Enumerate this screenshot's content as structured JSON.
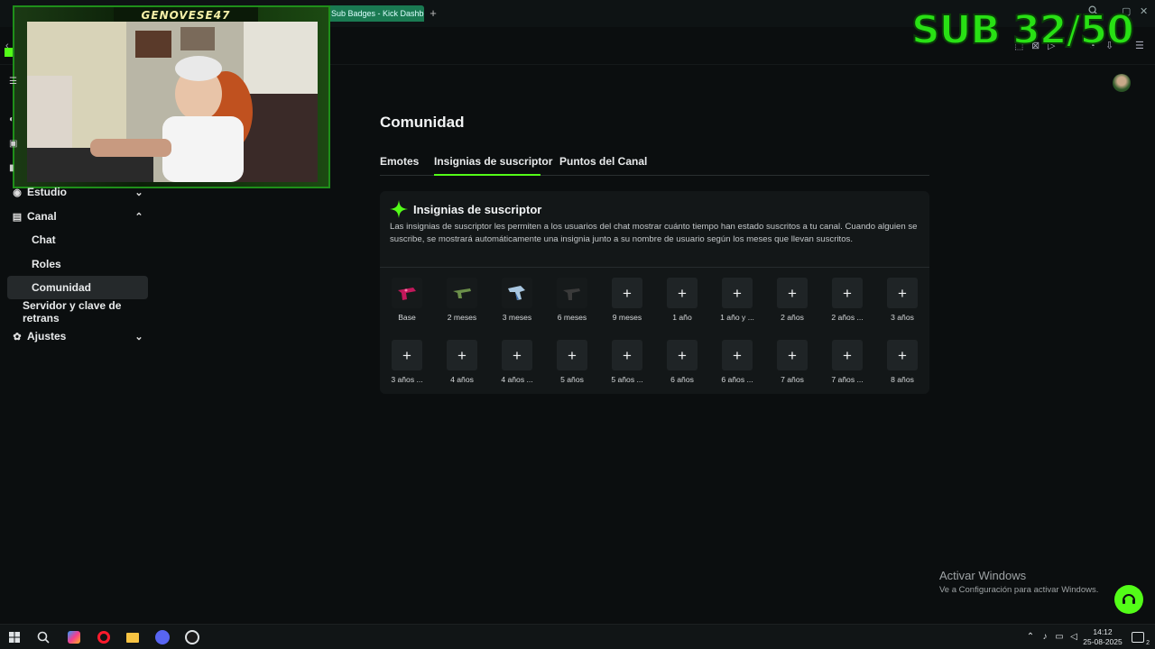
{
  "browser": {
    "active_tab": "Sub Badges - Kick Dashb",
    "new_tab": "+",
    "win_min": "–",
    "win_max": "▢",
    "win_close": "✕"
  },
  "overlay": {
    "sub_goal": "SUB 32/50",
    "streamer_name": "GENOVESE47"
  },
  "sidebar": {
    "items": [
      {
        "label": "Estudio",
        "icon": "studio-icon",
        "expanded": false
      },
      {
        "label": "Canal",
        "icon": "channel-icon",
        "expanded": true
      },
      {
        "label": "Chat"
      },
      {
        "label": "Roles"
      },
      {
        "label": "Comunidad",
        "active": true
      },
      {
        "label": "Servidor y clave de retrans"
      },
      {
        "label": "Ajustes",
        "icon": "gear-icon",
        "expanded": false
      }
    ]
  },
  "main": {
    "title": "Comunidad",
    "tabs": [
      "Emotes",
      "Insignias de suscriptor",
      "Puntos del Canal"
    ],
    "active_tab": "Insignias de suscriptor",
    "card": {
      "title": "Insignias de suscriptor",
      "description": "Las insignias de suscriptor les permiten a los usuarios del chat mostrar cuánto tiempo han estado suscritos a tu canal. Cuando alguien se suscribe, se mostrará automáticamente una insignia junto a su nombre de usuario según los meses que llevan suscritos.",
      "badges_row1": [
        {
          "label": "Base",
          "type": "image"
        },
        {
          "label": "2 meses",
          "type": "image"
        },
        {
          "label": "3 meses",
          "type": "image"
        },
        {
          "label": "6 meses",
          "type": "image"
        },
        {
          "label": "9 meses",
          "type": "add"
        },
        {
          "label": "1 año",
          "type": "add"
        },
        {
          "label": "1 año y ...",
          "type": "add"
        },
        {
          "label": "2 años",
          "type": "add"
        },
        {
          "label": "2 años ...",
          "type": "add"
        },
        {
          "label": "3 años",
          "type": "add"
        }
      ],
      "badges_row2": [
        {
          "label": "3 años ...",
          "type": "add"
        },
        {
          "label": "4 años",
          "type": "add"
        },
        {
          "label": "4 años ...",
          "type": "add"
        },
        {
          "label": "5 años",
          "type": "add"
        },
        {
          "label": "5 años ...",
          "type": "add"
        },
        {
          "label": "6 años",
          "type": "add"
        },
        {
          "label": "6 años ...",
          "type": "add"
        },
        {
          "label": "7 años",
          "type": "add"
        },
        {
          "label": "7 años ...",
          "type": "add"
        },
        {
          "label": "8 años",
          "type": "add"
        }
      ],
      "add_symbol": "+"
    }
  },
  "windows": {
    "activate_title": "Activar Windows",
    "activate_sub": "Ve a Configuración para activar Windows."
  },
  "taskbar": {
    "time": "14:12",
    "date": "25-08-2025",
    "notifications": "2"
  },
  "colors": {
    "accent": "#53fc18",
    "background": "#0b0e0f",
    "card": "#131718"
  }
}
